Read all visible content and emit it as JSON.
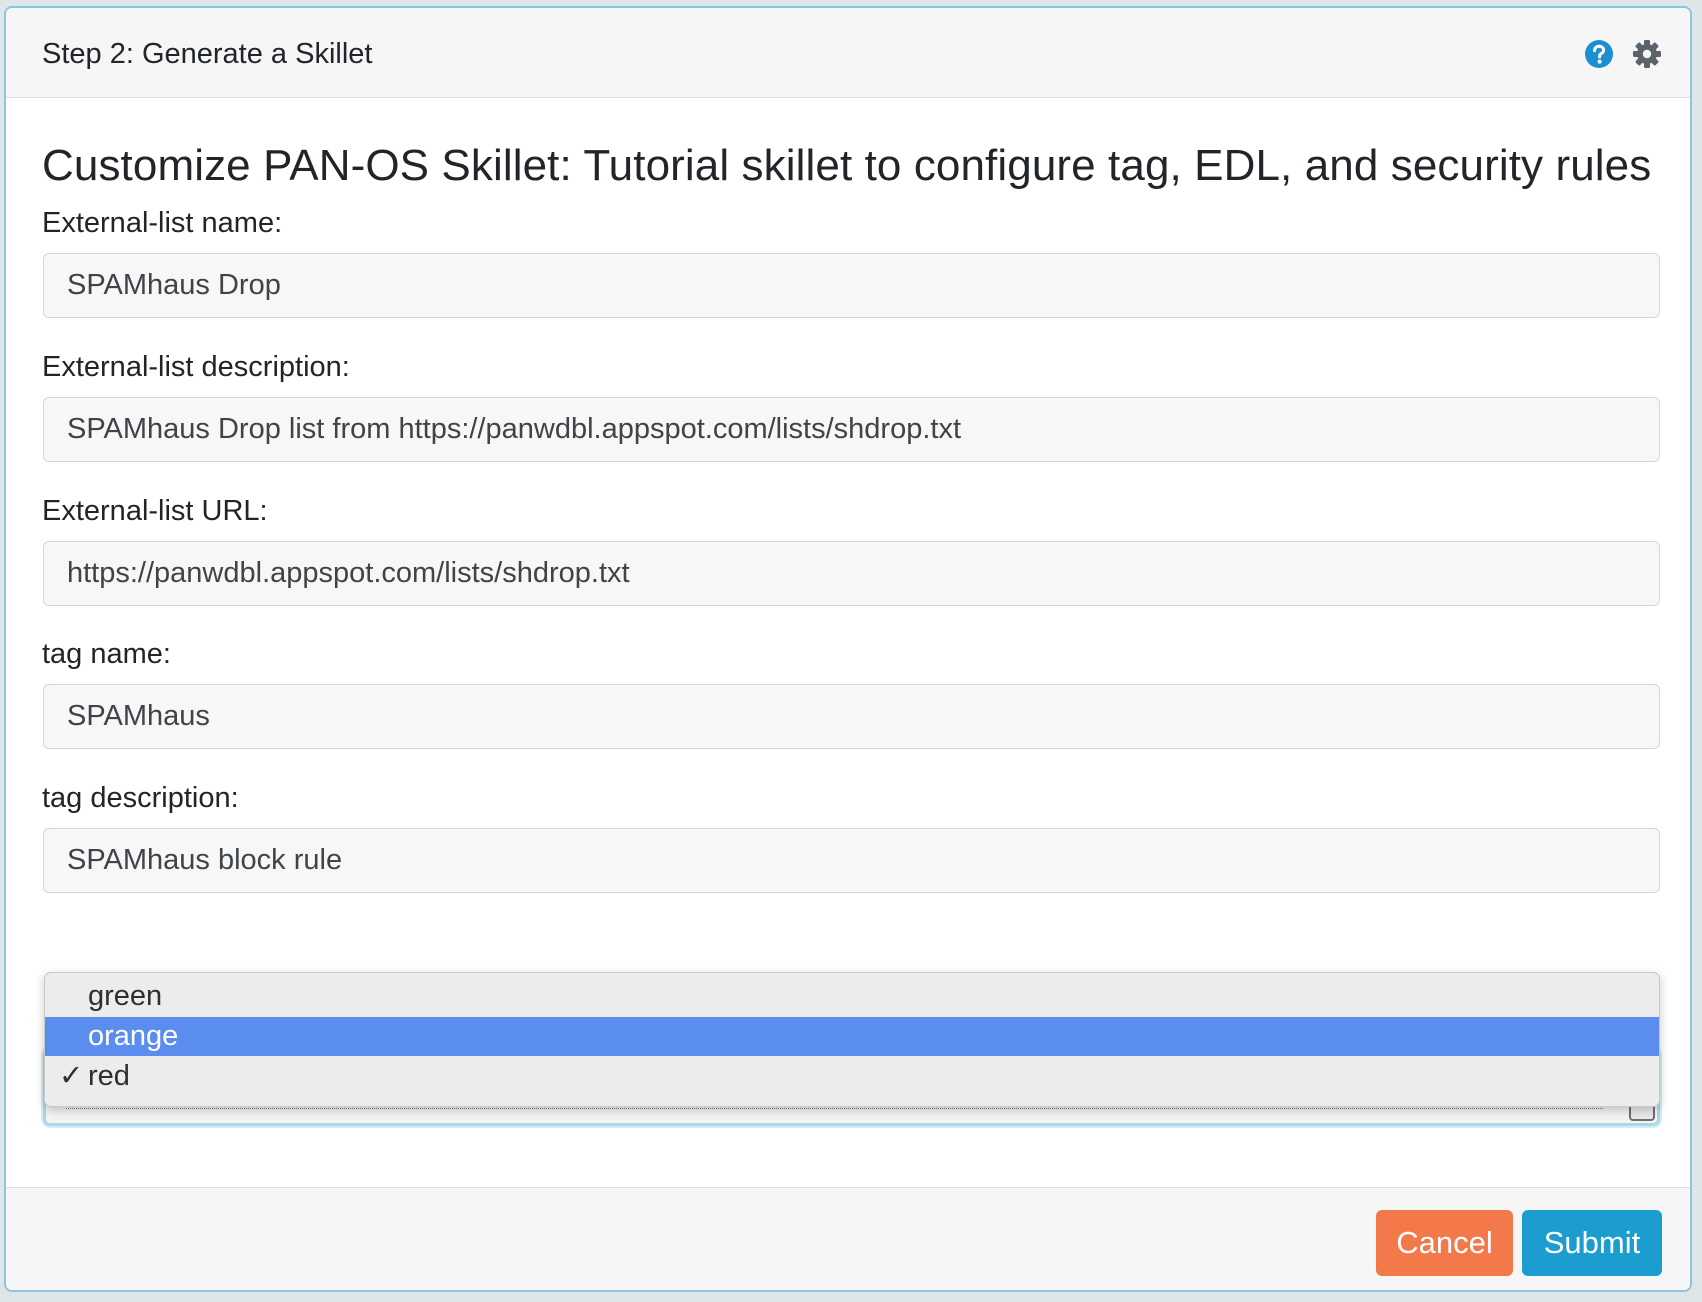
{
  "header": {
    "title": "Step 2: Generate a Skillet",
    "help_icon": "question-circle-icon",
    "settings_icon": "gear-icon",
    "help_color": "#1b8fd0",
    "settings_color": "#5b636b"
  },
  "main": {
    "title": "Customize PAN-OS Skillet: Tutorial skillet to configure tag, EDL, and security rules",
    "fields": [
      {
        "label": "External-list name:",
        "value": "SPAMhaus Drop"
      },
      {
        "label": "External-list description:",
        "value": "SPAMhaus Drop list from https://panwdbl.appspot.com/lists/shdrop.txt"
      },
      {
        "label": "External-list URL:",
        "value": "https://panwdbl.appspot.com/lists/shdrop.txt"
      },
      {
        "label": "tag name:",
        "value": "SPAMhaus"
      },
      {
        "label": "tag description:",
        "value": "SPAMhaus block rule"
      }
    ],
    "color_dropdown": {
      "options": [
        {
          "label": "green",
          "selected": false,
          "highlighted": false
        },
        {
          "label": "orange",
          "selected": false,
          "highlighted": true
        },
        {
          "label": "red",
          "selected": true,
          "highlighted": false
        }
      ],
      "check_mark": "✓",
      "highlight_color": "#5b8def"
    }
  },
  "footer": {
    "cancel_label": "Cancel",
    "submit_label": "Submit",
    "cancel_color": "#f4794a",
    "submit_color": "#1b9dcf"
  }
}
